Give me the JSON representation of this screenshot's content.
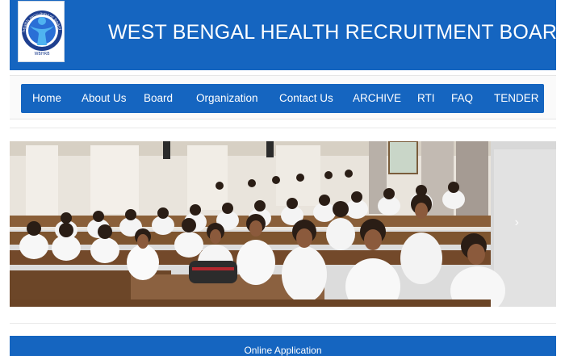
{
  "header": {
    "title": "WEST BENGAL HEALTH RECRUITMENT BOARD",
    "logo": {
      "arc_text": "health recruitment board",
      "sub_text": "WBHRB",
      "icon": "person-logo-icon"
    }
  },
  "nav": {
    "items": [
      {
        "label": "Home"
      },
      {
        "label": "About Us"
      },
      {
        "label": "Board"
      },
      {
        "label": "Organization"
      },
      {
        "label": "Contact Us"
      },
      {
        "label": "ARCHIVE"
      },
      {
        "label": "RTI"
      },
      {
        "label": "FAQ"
      },
      {
        "label": "TENDER"
      }
    ]
  },
  "slider": {
    "next_icon": "chevron-right-icon",
    "next_glyph": "›"
  },
  "online_application": {
    "label": "Online Application"
  },
  "colors": {
    "brand_blue": "#1565c0",
    "white": "#ffffff"
  }
}
